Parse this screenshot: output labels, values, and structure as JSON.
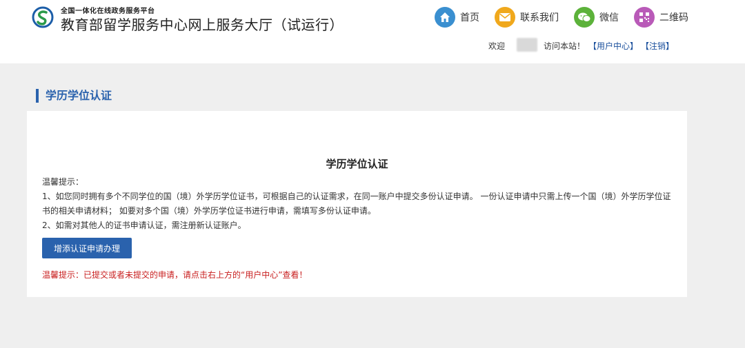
{
  "header": {
    "platform_label": "全国一体化在线政务服务平台",
    "site_title": "教育部留学服务中心网上服务大厅（试运行）",
    "nav": [
      {
        "label": "首页",
        "icon": "home-icon",
        "color": "#3a8fd0"
      },
      {
        "label": "联系我们",
        "icon": "mail-icon",
        "color": "#f0a81c"
      },
      {
        "label": "微信",
        "icon": "wechat-icon",
        "color": "#5cb23a"
      },
      {
        "label": "二维码",
        "icon": "qrcode-icon",
        "color": "#b95ab8"
      }
    ],
    "welcome": "欢迎",
    "visit_text": "访问本站！",
    "user_center": "【用户中心】",
    "logout": "【注销】"
  },
  "section": {
    "title": "学历学位认证"
  },
  "panel": {
    "heading": "学历学位认证",
    "tips_label": "温馨提示：",
    "tip1": "1、如您同时拥有多个不同学位的国（境）外学历学位证书，可根据自己的认证需求，在同一账户中提交多份认证申请。 一份认证申请中只需上传一个国（境）外学历学位证书的相关申请材料； 如要对多个国（境）外学历学位证书进行申请，需填写多份认证申请。",
    "tip2": "2、如需对其他人的证书申请认证，需注册新认证账户。",
    "add_button": "增添认证申请办理",
    "red_tip": "温馨提示：已提交或者未提交的申请，请点击右上方的“用户中心”查看！"
  },
  "colors": {
    "accent": "#2a62ad",
    "warning": "#c81e1e"
  }
}
